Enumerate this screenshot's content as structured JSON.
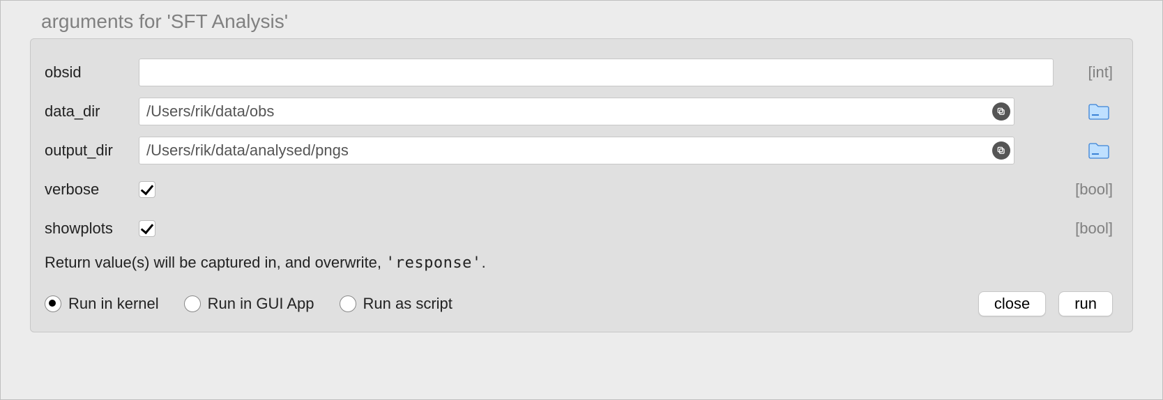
{
  "title": "arguments for 'SFT Analysis'",
  "fields": {
    "obsid": {
      "label": "obsid",
      "value": "",
      "type_hint": "[int]"
    },
    "data_dir": {
      "label": "data_dir",
      "value": "/Users/rik/data/obs",
      "type_hint": ""
    },
    "output_dir": {
      "label": "output_dir",
      "value": "/Users/rik/data/analysed/pngs",
      "type_hint": ""
    },
    "verbose": {
      "label": "verbose",
      "checked": true,
      "type_hint": "[bool]"
    },
    "showplots": {
      "label": "showplots",
      "checked": true,
      "type_hint": "[bool]"
    }
  },
  "note": {
    "prefix": "Return value(s) will be captured in, and overwrite, ",
    "var": "'response'",
    "suffix": "."
  },
  "run_modes": {
    "kernel": "Run in kernel",
    "gui": "Run in GUI App",
    "script": "Run as script",
    "selected": "kernel"
  },
  "buttons": {
    "close": "close",
    "run": "run"
  }
}
